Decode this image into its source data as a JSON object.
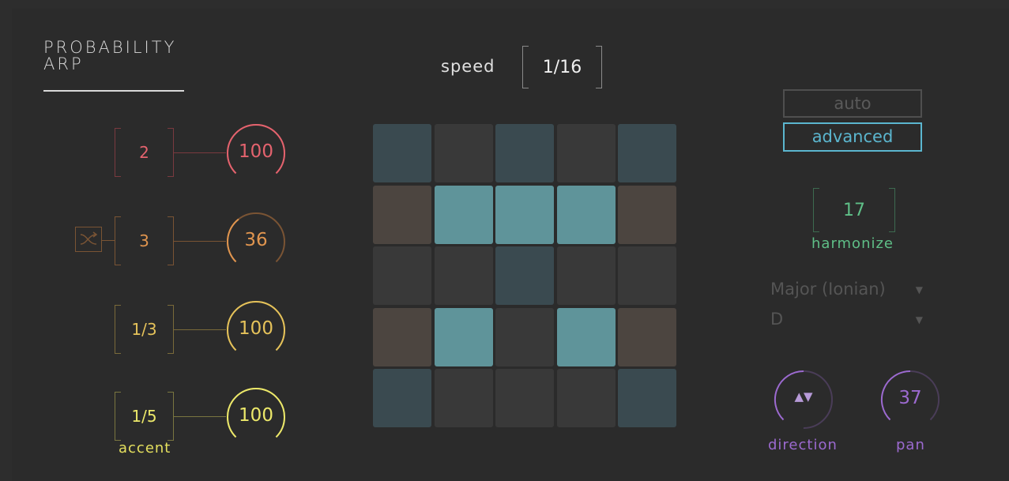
{
  "app": {
    "title_line1": "PROBABILITY",
    "title_line2": "ARP"
  },
  "speed": {
    "label": "speed",
    "value": "1/16"
  },
  "rows": [
    {
      "division": "2",
      "probability": "100",
      "color": "#e4636e",
      "dim": "#7a3a3f"
    },
    {
      "division": "3",
      "probability": "36",
      "color": "#e0954f",
      "dim": "#7a5434"
    },
    {
      "division": "1/3",
      "probability": "100",
      "color": "#e5c25a",
      "dim": "#7a6a3a"
    },
    {
      "division": "1/5",
      "probability": "100",
      "color": "#ece86a",
      "dim": "#7a7640"
    }
  ],
  "accent": {
    "label": "accent"
  },
  "shuffle": {
    "icon": "shuffle-icon"
  },
  "grid": {
    "colors": {
      "teal_dark": "#3a4a50",
      "grey": "#393939",
      "brown": "#4c4540",
      "teal_light": "#5f949a"
    },
    "cells": [
      [
        "teal_dark",
        "grey",
        "teal_dark",
        "grey",
        "teal_dark"
      ],
      [
        "brown",
        "teal_light",
        "teal_light",
        "teal_light",
        "brown"
      ],
      [
        "grey",
        "grey",
        "teal_dark",
        "grey",
        "grey"
      ],
      [
        "brown",
        "teal_light",
        "grey",
        "teal_light",
        "brown"
      ],
      [
        "teal_dark",
        "grey",
        "grey",
        "grey",
        "teal_dark"
      ]
    ]
  },
  "mode": {
    "auto": "auto",
    "advanced": "advanced"
  },
  "harmonize": {
    "value": "17",
    "label": "harmonize"
  },
  "scale": {
    "selected": "Major (Ionian)"
  },
  "key": {
    "selected": "D"
  },
  "direction": {
    "symbol": "▲▼",
    "label": "direction"
  },
  "pan": {
    "value": "37",
    "label": "pan"
  },
  "colors": {
    "accent_teal": "#5bb6cf",
    "harmonize_green": "#5fbf87",
    "purple": "#9c6ad0"
  }
}
